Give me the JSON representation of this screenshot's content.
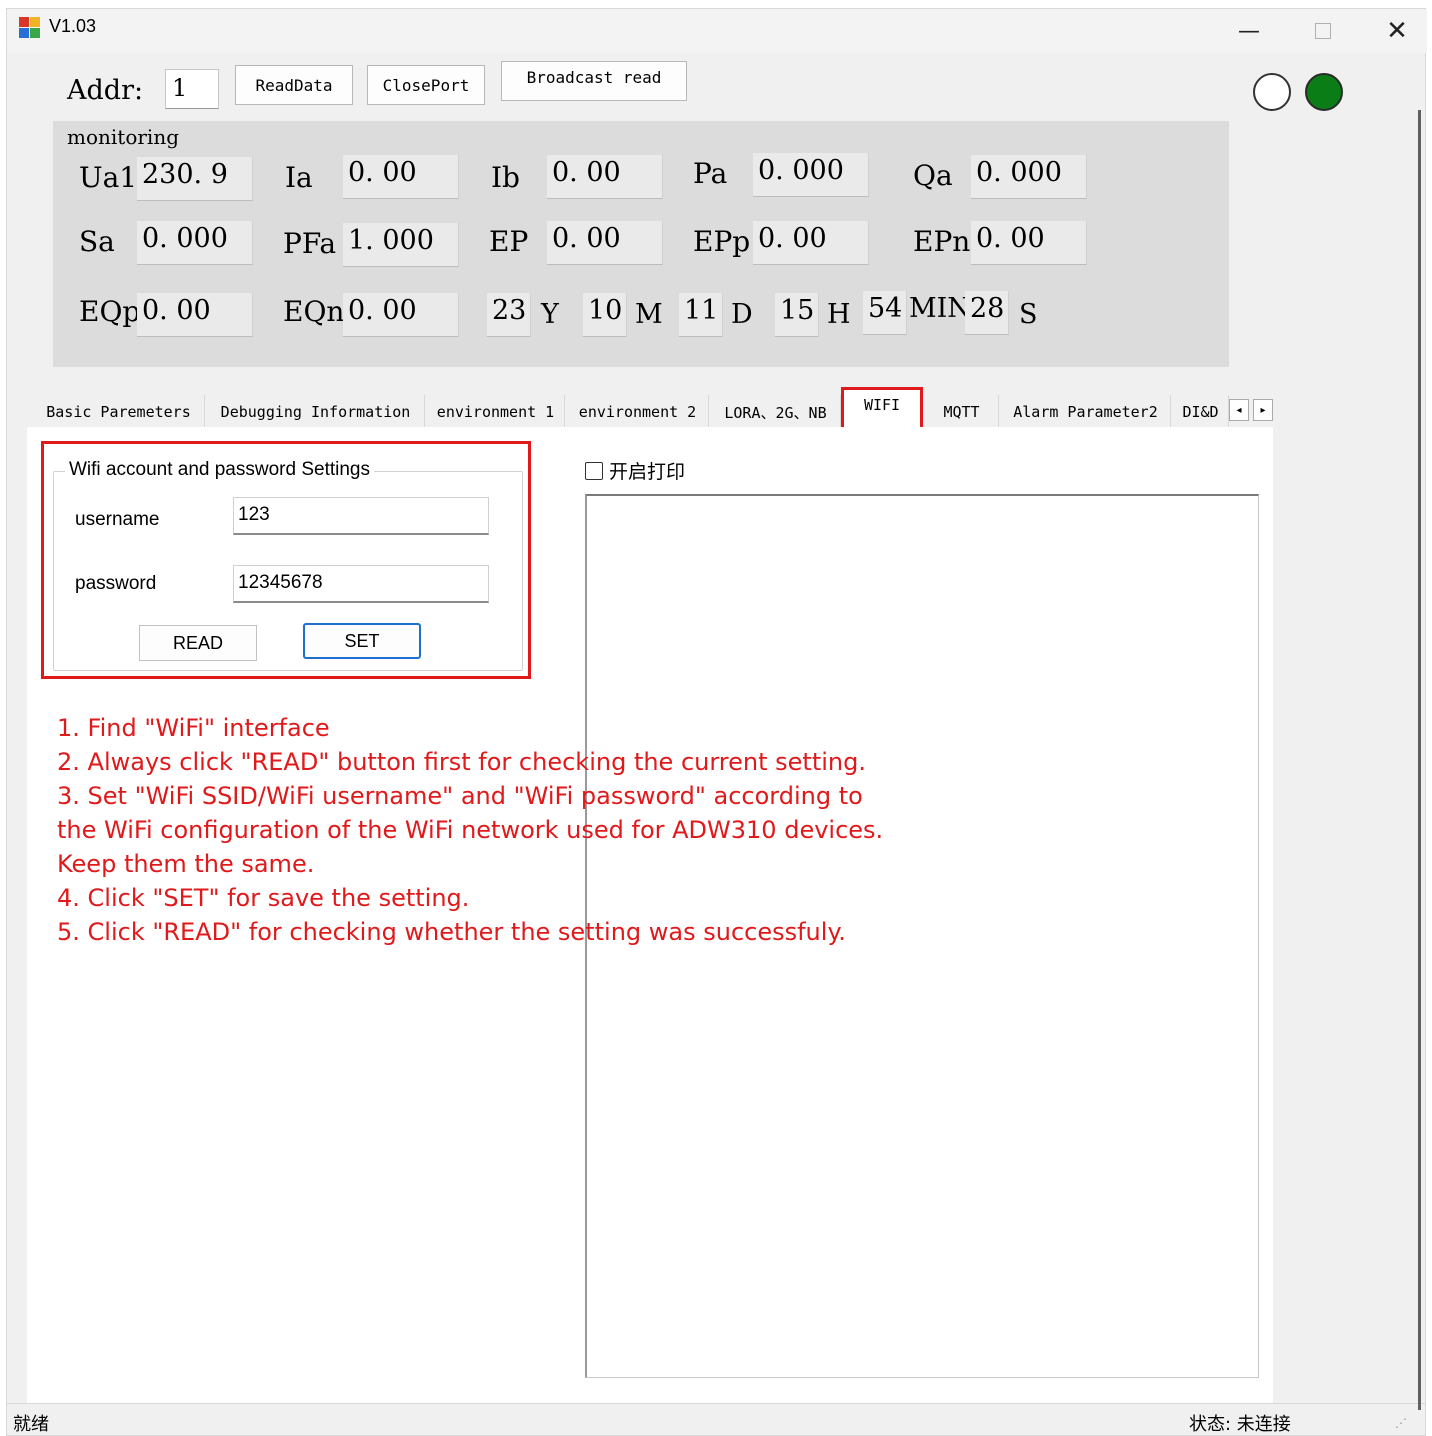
{
  "window": {
    "title": "V1.03",
    "min_glyph": "—",
    "close_glyph": "✕"
  },
  "toolbar": {
    "addr_label": "Addr:",
    "addr_value": "1",
    "readdata_label": "ReadData",
    "closeport_label": "ClosePort",
    "broadcast_label": "Broadcast read",
    "led_colors": {
      "off": "#ffffff",
      "on": "#0a7d16"
    }
  },
  "monitoring": {
    "title": "monitoring",
    "rows": [
      [
        {
          "label": "Ua1",
          "value": "230. 9"
        },
        {
          "label": "Ia",
          "value": "0. 00"
        },
        {
          "label": "Ib",
          "value": "0. 00"
        },
        {
          "label": "Pa",
          "value": "0. 000"
        },
        {
          "label": "Qa",
          "value": "0. 000"
        }
      ],
      [
        {
          "label": "Sa",
          "value": "0. 000"
        },
        {
          "label": "PFa",
          "value": "1. 000"
        },
        {
          "label": "EP",
          "value": "0. 00"
        },
        {
          "label": "EPp",
          "value": "0. 00"
        },
        {
          "label": "EPn",
          "value": "0. 00"
        }
      ]
    ],
    "energy": [
      {
        "label": "EQp",
        "value": "0. 00"
      },
      {
        "label": "EQn",
        "value": "0. 00"
      }
    ],
    "datetime": [
      {
        "value": "23",
        "unit": "Y"
      },
      {
        "value": "10",
        "unit": "M"
      },
      {
        "value": "11",
        "unit": "D"
      },
      {
        "value": "15",
        "unit": "H"
      },
      {
        "value": "54",
        "unit": "MIN"
      },
      {
        "value": "28",
        "unit": "S"
      }
    ]
  },
  "tabs": [
    {
      "label": "Basic Paremeters"
    },
    {
      "label": "Debugging Information"
    },
    {
      "label": "environment 1"
    },
    {
      "label": "environment 2"
    },
    {
      "label": "LORA、2G、NB"
    },
    {
      "label": "WIFI",
      "active": true
    },
    {
      "label": "MQTT"
    },
    {
      "label": "Alarm Parameter2"
    },
    {
      "label": "DI&D"
    }
  ],
  "tab_scroll": {
    "left": "◂",
    "right": "▸"
  },
  "wifi": {
    "group_title": "Wifi account and password Settings",
    "username_label": "username",
    "username_value": "123",
    "password_label": "password",
    "password_value": "12345678",
    "read_label": "READ",
    "set_label": "SET",
    "highlight_color": "#e0191b"
  },
  "print_toggle": {
    "label": "开启打印",
    "checked": false
  },
  "instructions": [
    "1. Find \"WiFi\" interface",
    "2. Always click \"READ\" button first for checking the current setting.",
    "3. Set \"WiFi SSID/WiFi username\" and \"WiFi password\" according to",
    "the WiFi configuration of the WiFi network used for ADW310 devices.",
    "Keep them the same.",
    "4. Click \"SET\" for save the setting.",
    "5. Click \"READ\" for checking whether the setting was successfuly."
  ],
  "statusbar": {
    "left": "就绪",
    "right": "状态: 未连接"
  }
}
